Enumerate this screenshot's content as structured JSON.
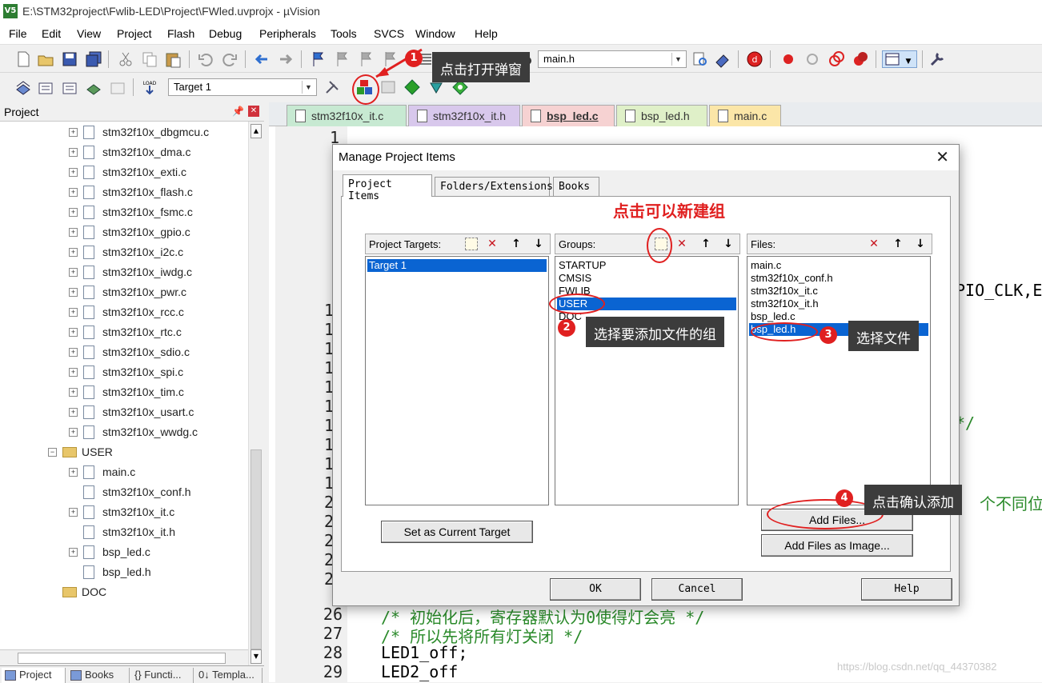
{
  "window": {
    "title": "E:\\STM32project\\Fwlib-LED\\Project\\FWled.uvprojx - µVision",
    "app_icon": "V5"
  },
  "menu": [
    "File",
    "Edit",
    "View",
    "Project",
    "Flash",
    "Debug",
    "Peripherals",
    "Tools",
    "SVCS",
    "Window",
    "Help"
  ],
  "toolbar": {
    "file_combo": "main.h",
    "target_combo": "Target 1"
  },
  "project_panel": {
    "title": "Project",
    "tree": [
      {
        "label": "stm32f10x_dbgmcu.c",
        "expander": "+"
      },
      {
        "label": "stm32f10x_dma.c",
        "expander": "+"
      },
      {
        "label": "stm32f10x_exti.c",
        "expander": "+"
      },
      {
        "label": "stm32f10x_flash.c",
        "expander": "+"
      },
      {
        "label": "stm32f10x_fsmc.c",
        "expander": "+"
      },
      {
        "label": "stm32f10x_gpio.c",
        "expander": "+"
      },
      {
        "label": "stm32f10x_i2c.c",
        "expander": "+"
      },
      {
        "label": "stm32f10x_iwdg.c",
        "expander": "+"
      },
      {
        "label": "stm32f10x_pwr.c",
        "expander": "+"
      },
      {
        "label": "stm32f10x_rcc.c",
        "expander": "+"
      },
      {
        "label": "stm32f10x_rtc.c",
        "expander": "+"
      },
      {
        "label": "stm32f10x_sdio.c",
        "expander": "+"
      },
      {
        "label": "stm32f10x_spi.c",
        "expander": "+"
      },
      {
        "label": "stm32f10x_tim.c",
        "expander": "+"
      },
      {
        "label": "stm32f10x_usart.c",
        "expander": "+"
      },
      {
        "label": "stm32f10x_wwdg.c",
        "expander": "+"
      },
      {
        "label": "USER",
        "expander": "−",
        "folder": true
      },
      {
        "label": "main.c",
        "expander": "+"
      },
      {
        "label": "stm32f10x_conf.h",
        "expander": ""
      },
      {
        "label": "stm32f10x_it.c",
        "expander": "+"
      },
      {
        "label": "stm32f10x_it.h",
        "expander": ""
      },
      {
        "label": "bsp_led.c",
        "expander": "+"
      },
      {
        "label": "bsp_led.h",
        "expander": ""
      },
      {
        "label": "DOC",
        "expander": "",
        "folder": true
      }
    ],
    "bottom_tabs": [
      "Project",
      "Books",
      "{} Functi...",
      "0↓ Templa..."
    ]
  },
  "editor": {
    "tabs": [
      {
        "label": "stm32f10x_it.c",
        "color": "#c7e9d2"
      },
      {
        "label": "stm32f10x_it.h",
        "color": "#d8c8ec"
      },
      {
        "label": "bsp_led.c",
        "color": "#f6d2d2",
        "active": true
      },
      {
        "label": "bsp_led.h",
        "color": "#dff0c8"
      },
      {
        "label": "main.c",
        "color": "#fbe6a8"
      }
    ],
    "line_numbers_partial": [
      "1",
      "1",
      "1",
      "1",
      "1",
      "1",
      "1",
      "1",
      "1",
      "1",
      "2",
      "2",
      "2",
      "2",
      "2"
    ],
    "lines": [
      {
        "n": "26",
        "text": "/* 初始化后，寄存器默认为0使得灯会亮 */",
        "comment": true
      },
      {
        "n": "27",
        "text": "/* 所以先将所有灯关闭 */",
        "comment": true
      },
      {
        "n": "28",
        "text": "LED1_off;",
        "comment": false
      },
      {
        "n": "29",
        "text": "LED2_off",
        "comment": false
      }
    ],
    "right_fragments": [
      "PIO_CLK,E",
      "*/",
      "个不同位"
    ]
  },
  "dialog": {
    "title": "Manage Project Items",
    "tabs": [
      "Project Items",
      "Folders/Extensions",
      "Books"
    ],
    "targets": {
      "label": "Project Targets:",
      "items": [
        "Target 1"
      ]
    },
    "groups": {
      "label": "Groups:",
      "items": [
        "STARTUP",
        "CMSIS",
        "FWLIB",
        "USER",
        "DOC"
      ],
      "selected": "USER"
    },
    "files": {
      "label": "Files:",
      "items": [
        "main.c",
        "stm32f10x_conf.h",
        "stm32f10x_it.c",
        "stm32f10x_it.h",
        "bsp_led.c",
        "bsp_led.h"
      ],
      "selected": "bsp_led.h"
    },
    "buttons": {
      "set_current": "Set as Current Target",
      "add_files": "Add Files...",
      "add_files_image": "Add Files as Image...",
      "ok": "OK",
      "cancel": "Cancel",
      "help": "Help"
    }
  },
  "annotations": {
    "new_group_hint": "点击可以新建组",
    "step1": {
      "num": "1",
      "text": "点击打开弹窗"
    },
    "step2": {
      "num": "2",
      "text": "选择要添加文件的组"
    },
    "step3": {
      "num": "3",
      "text": "选择文件"
    },
    "step4": {
      "num": "4",
      "text": "点击确认添加"
    }
  },
  "watermark": "https://blog.csdn.net/qq_44370382"
}
